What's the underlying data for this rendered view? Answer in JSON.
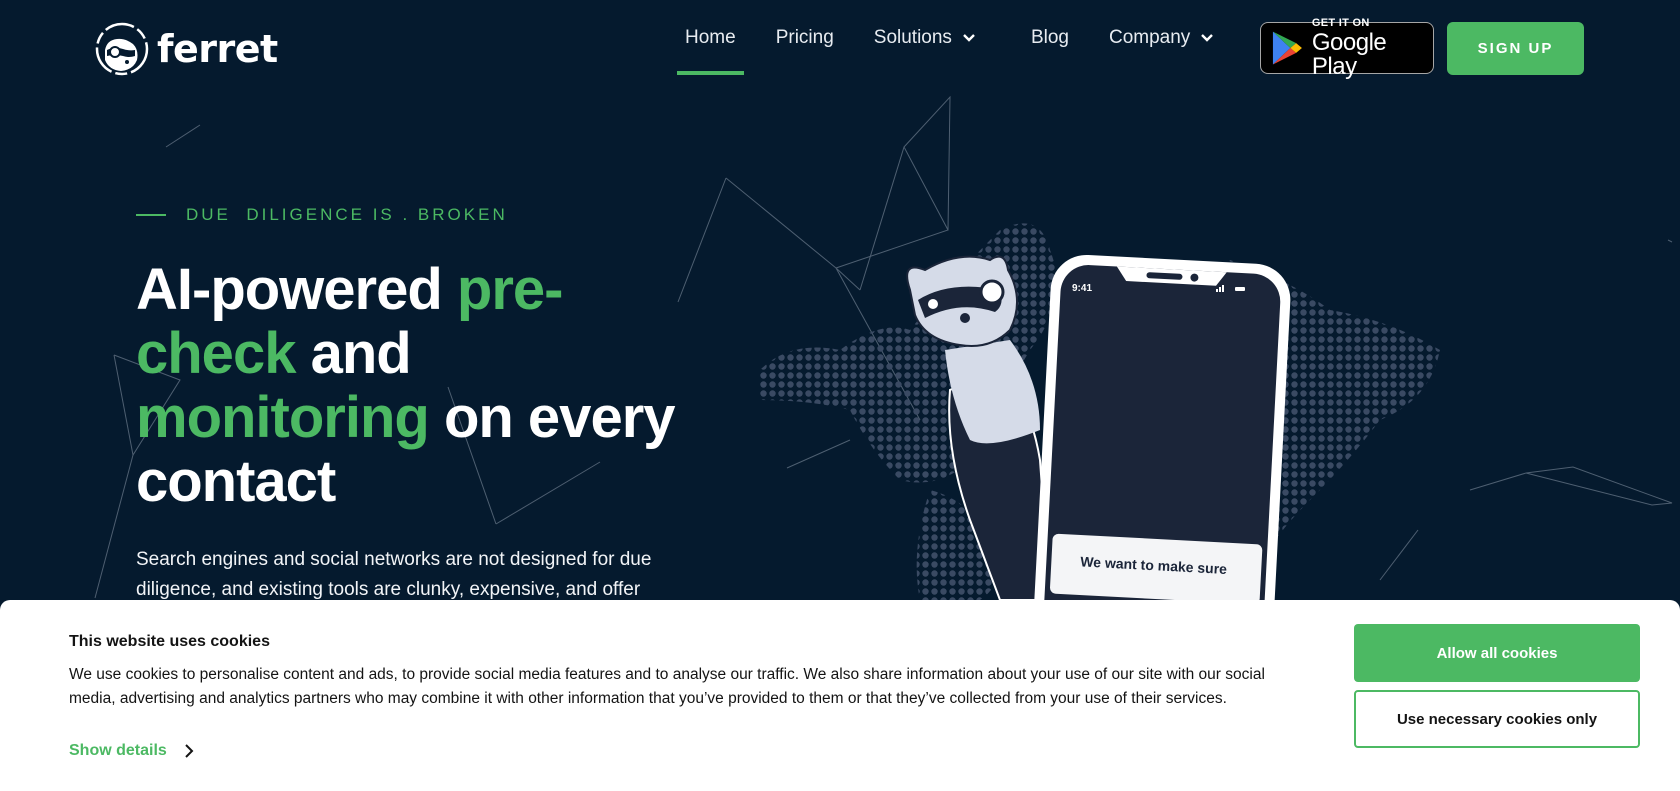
{
  "brand": {
    "name": "ferret",
    "accent": "#4cb963",
    "background": "#051a2e"
  },
  "nav": {
    "items": [
      {
        "label": "Home",
        "active": true,
        "dropdown": false
      },
      {
        "label": "Pricing",
        "active": false,
        "dropdown": false
      },
      {
        "label": "Solutions",
        "active": false,
        "dropdown": true
      },
      {
        "label": "Blog",
        "active": false,
        "dropdown": false
      },
      {
        "label": "Company",
        "active": false,
        "dropdown": true
      }
    ],
    "google_play": {
      "small": "GET IT ON",
      "big": "Google Play"
    },
    "signup_label": "SIGN UP"
  },
  "hero": {
    "eyebrow": "DUE  DILIGENCE IS . BROKEN",
    "headline": {
      "w1": "AI-powered ",
      "g1": "pre-check",
      "w2": " and ",
      "g2": "monitoring",
      "w3": " on every contact"
    },
    "description": "Search engines and social networks are not designed for due diligence, and existing tools are clunky, expensive, and offer",
    "phone": {
      "time": "9:41",
      "card_text": "We want to make sure this is you. To..."
    }
  },
  "cookie_banner": {
    "title": "This website uses cookies",
    "body": "We use cookies to personalise content and ads, to provide social media features and to analyse our traffic. We also share information about your use of our site with our social media, advertising and analytics partners who may combine it with other information that you’ve provided to them or that they’ve collected from your use of their services.",
    "show_details": "Show details",
    "allow_all": "Allow all cookies",
    "necessary_only": "Use necessary cookies only"
  }
}
